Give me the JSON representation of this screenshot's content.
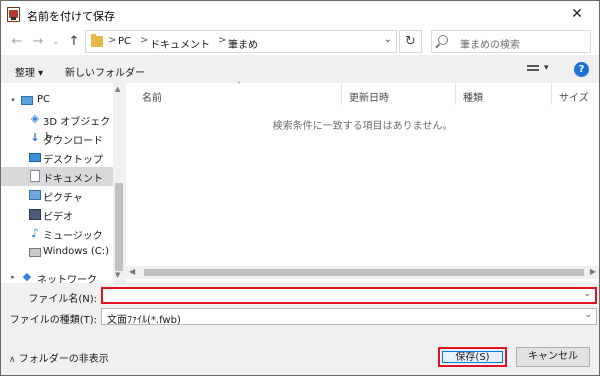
{
  "window": {
    "title": "名前を付けて保存",
    "close_label": "✕"
  },
  "nav": {
    "back_icon": "←",
    "forward_icon": "→",
    "recent_icon": "⌄",
    "up_icon": "↑"
  },
  "address": {
    "crumbs": [
      "PC",
      "ドキュメント",
      "筆まめ"
    ],
    "separator": ">",
    "dropdown_icon": "⌄"
  },
  "refresh_icon": "↻",
  "search": {
    "placeholder": "筆まめの検索"
  },
  "toolbar": {
    "organize_label": "整理 ▾",
    "new_folder_label": "新しいフォルダー",
    "view_dd": "▾",
    "help_label": "?"
  },
  "sidebar": {
    "items": [
      {
        "label": "PC",
        "icon": "computer-icon"
      },
      {
        "label": "3D オブジェクト",
        "icon": "3d-objects-icon"
      },
      {
        "label": "ダウンロード",
        "icon": "download-icon"
      },
      {
        "label": "デスクトップ",
        "icon": "desktop-icon"
      },
      {
        "label": "ドキュメント",
        "icon": "documents-icon"
      },
      {
        "label": "ピクチャ",
        "icon": "pictures-icon"
      },
      {
        "label": "ビデオ",
        "icon": "videos-icon"
      },
      {
        "label": "ミュージック",
        "icon": "music-icon"
      },
      {
        "label": "Windows (C:)",
        "icon": "drive-icon"
      },
      {
        "label": "ネットワーク",
        "icon": "network-icon"
      }
    ],
    "selected_index": 4
  },
  "columns": {
    "name": "名前",
    "modified": "更新日時",
    "type": "種類",
    "size": "サイズ"
  },
  "empty_message": "検索条件に一致する項目はありません。",
  "form": {
    "filename_label": "ファイル名(N):",
    "filename_value": "",
    "filetype_label": "ファイルの種類(T):",
    "filetype_value": "文面ﾌｧｲﾙ(*.fwb)"
  },
  "footer": {
    "hide_folders_label": "フォルダーの非表示"
  },
  "buttons": {
    "save_label": "保存(S)",
    "cancel_label": "キャンセル"
  },
  "colors": {
    "highlight": "#e0141e",
    "accent": "#0078d7",
    "help": "#1e73d2"
  }
}
